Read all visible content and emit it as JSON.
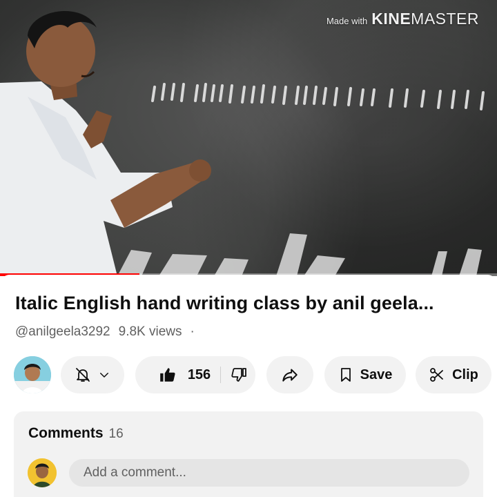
{
  "video": {
    "watermark_prefix": "Made with",
    "watermark_brand_bold": "KINE",
    "watermark_brand_light": "MASTER",
    "progress": 0.28
  },
  "details": {
    "title": "Italic English hand writing class by anil geela...",
    "channel_handle": "@anilgeela3292",
    "views": "9.8K views",
    "views_separator": "·"
  },
  "actions": {
    "notifications_icon": "bell-off-icon",
    "like_count": "156",
    "save_label": "Save",
    "clip_label": "Clip"
  },
  "comments": {
    "heading": "Comments",
    "count": "16",
    "add_placeholder": "Add a comment..."
  },
  "colors": {
    "accent": "#ff0000",
    "pill_bg": "#f2f2f2",
    "text_secondary": "#606060"
  }
}
